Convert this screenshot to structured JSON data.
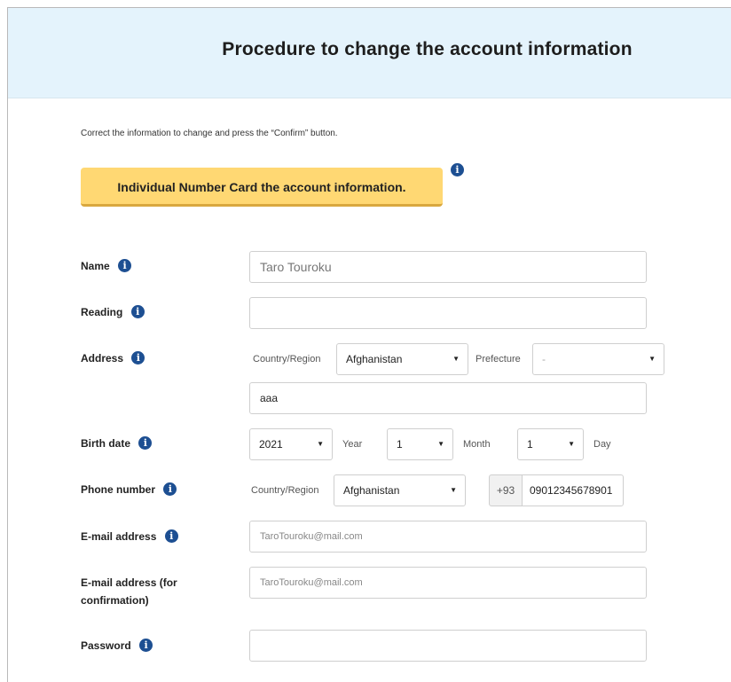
{
  "page": {
    "title": "Procedure to change the account information",
    "instruction": "Correct the information to change and press the “Confirm” button.",
    "my_number_button": "Individual Number Card the account information."
  },
  "form": {
    "name": {
      "label": "Name",
      "value": "Taro Touroku"
    },
    "reading": {
      "label": "Reading",
      "value": ""
    },
    "address": {
      "label": "Address",
      "country_label": "Country/Region",
      "country_value": "Afghanistan",
      "prefecture_label": "Prefecture",
      "prefecture_value": "-",
      "detail_value": "aaa"
    },
    "birth_date": {
      "label": "Birth date",
      "year_value": "2021",
      "year_label": "Year",
      "month_value": "1",
      "month_label": "Month",
      "day_value": "1",
      "day_label": "Day"
    },
    "phone": {
      "label": "Phone number",
      "country_label": "Country/Region",
      "country_value": "Afghanistan",
      "code": "+93",
      "value": "09012345678901"
    },
    "email": {
      "label": "E-mail address",
      "placeholder": "TaroTouroku@mail.com"
    },
    "email_confirm": {
      "label": "E-mail address (for confirmation)",
      "placeholder": "TaroTouroku@mail.com"
    },
    "password": {
      "label": "Password",
      "value": ""
    }
  },
  "icons": {
    "info": "info-icon",
    "dropdown": "caret-down-icon"
  },
  "colors": {
    "header_bg": "#e4f3fc",
    "button_bg": "#ffd873",
    "info_icon": "#1d4f92"
  }
}
